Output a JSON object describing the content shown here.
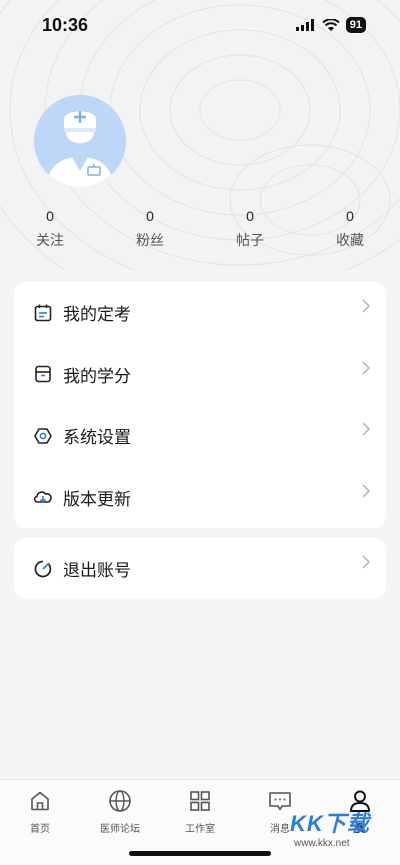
{
  "status_bar": {
    "time": "10:36",
    "battery": "91"
  },
  "profile": {
    "stats": [
      {
        "value": "0",
        "label": "关注"
      },
      {
        "value": "0",
        "label": "粉丝"
      },
      {
        "value": "0",
        "label": "帖子"
      },
      {
        "value": "0",
        "label": "收藏"
      }
    ]
  },
  "menu": {
    "items": [
      {
        "label": "我的定考",
        "icon": "calendar-icon"
      },
      {
        "label": "我的学分",
        "icon": "box-icon"
      },
      {
        "label": "系统设置",
        "icon": "hexagon-settings-icon"
      },
      {
        "label": "版本更新",
        "icon": "cloud-download-icon"
      }
    ],
    "logout": {
      "label": "退出账号",
      "icon": "logout-circle-icon"
    }
  },
  "tabbar": {
    "items": [
      {
        "label": "首页",
        "icon": "home-icon"
      },
      {
        "label": "医师论坛",
        "icon": "globe-icon"
      },
      {
        "label": "工作室",
        "icon": "grid-icon"
      },
      {
        "label": "消息",
        "icon": "message-icon"
      },
      {
        "label": "我",
        "icon": "user-icon",
        "active": true
      }
    ]
  },
  "watermark": {
    "text": "KK下载",
    "url": "www.kkx.net"
  },
  "colors": {
    "accent": "#2b7de0",
    "avatar_bg": "#bcd7f7"
  }
}
